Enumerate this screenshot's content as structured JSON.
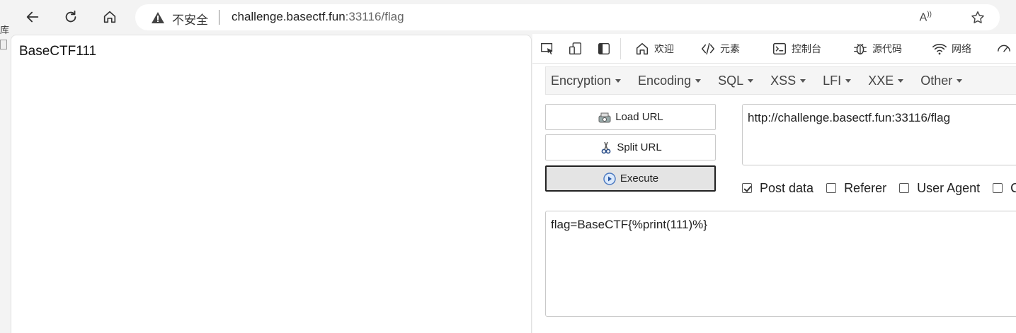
{
  "browser": {
    "security_label": "不安全",
    "url_host": "challenge.basectf.fun",
    "url_rest": ":33116/flag",
    "read_aloud_label": "A̅"
  },
  "page": {
    "content": "BaseCTF111"
  },
  "devtools": {
    "tabs": [
      {
        "label": "欢迎",
        "icon": "home-icon"
      },
      {
        "label": "元素",
        "icon": "code-icon"
      },
      {
        "label": "控制台",
        "icon": "console-icon"
      },
      {
        "label": "源代码",
        "icon": "bug-icon"
      },
      {
        "label": "网络",
        "icon": "wifi-icon"
      }
    ]
  },
  "hackbar": {
    "menu": [
      "Encryption",
      "Encoding",
      "SQL",
      "XSS",
      "LFI",
      "XXE",
      "Other"
    ],
    "load_url": "Load URL",
    "split_url": "Split URL",
    "execute": "Execute",
    "url_value": "http://challenge.basectf.fun:33116/flag",
    "options": [
      {
        "label": "Post data",
        "checked": true
      },
      {
        "label": "Referer",
        "checked": false
      },
      {
        "label": "User Agent",
        "checked": false
      },
      {
        "label": "Co",
        "checked": false
      }
    ],
    "post_value": "flag=BaseCTF{%print(111)%}"
  }
}
